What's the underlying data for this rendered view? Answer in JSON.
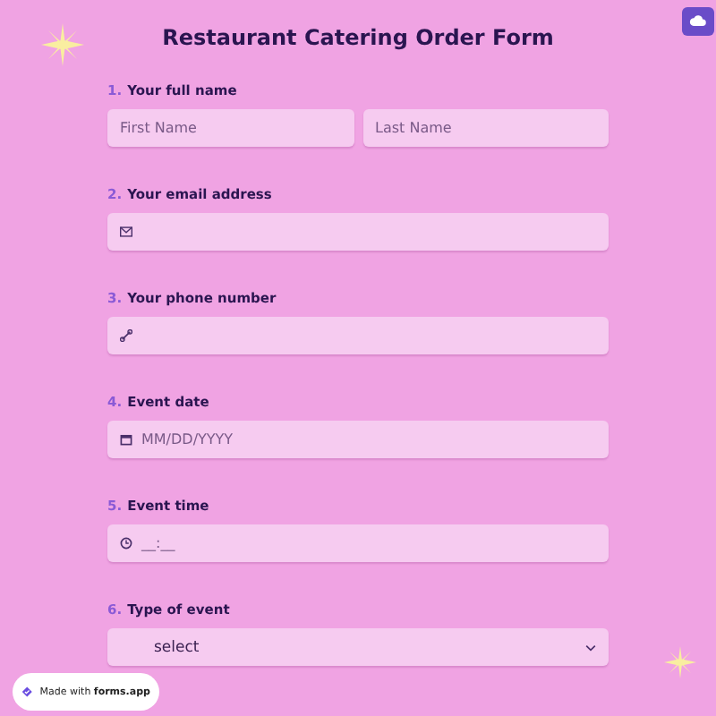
{
  "title": "Restaurant Catering Order Form",
  "questions": [
    {
      "number": "1.",
      "label": "Your full name",
      "kind": "name",
      "fields": [
        {
          "placeholder": "First Name"
        },
        {
          "placeholder": "Last Name"
        }
      ]
    },
    {
      "number": "2.",
      "label": "Your email address",
      "kind": "email"
    },
    {
      "number": "3.",
      "label": "Your phone number",
      "kind": "phone"
    },
    {
      "number": "4.",
      "label": "Event date",
      "kind": "date",
      "fields": [
        {
          "placeholder": "MM/DD/YYYY"
        }
      ]
    },
    {
      "number": "5.",
      "label": "Event time",
      "kind": "time",
      "fields": [
        {
          "placeholder": "__:__"
        }
      ]
    },
    {
      "number": "6.",
      "label": "Type of event",
      "kind": "select",
      "fields": [
        {
          "placeholder": "select"
        }
      ]
    }
  ],
  "badge": {
    "prefix": "Made with",
    "brand": "forms.app"
  }
}
